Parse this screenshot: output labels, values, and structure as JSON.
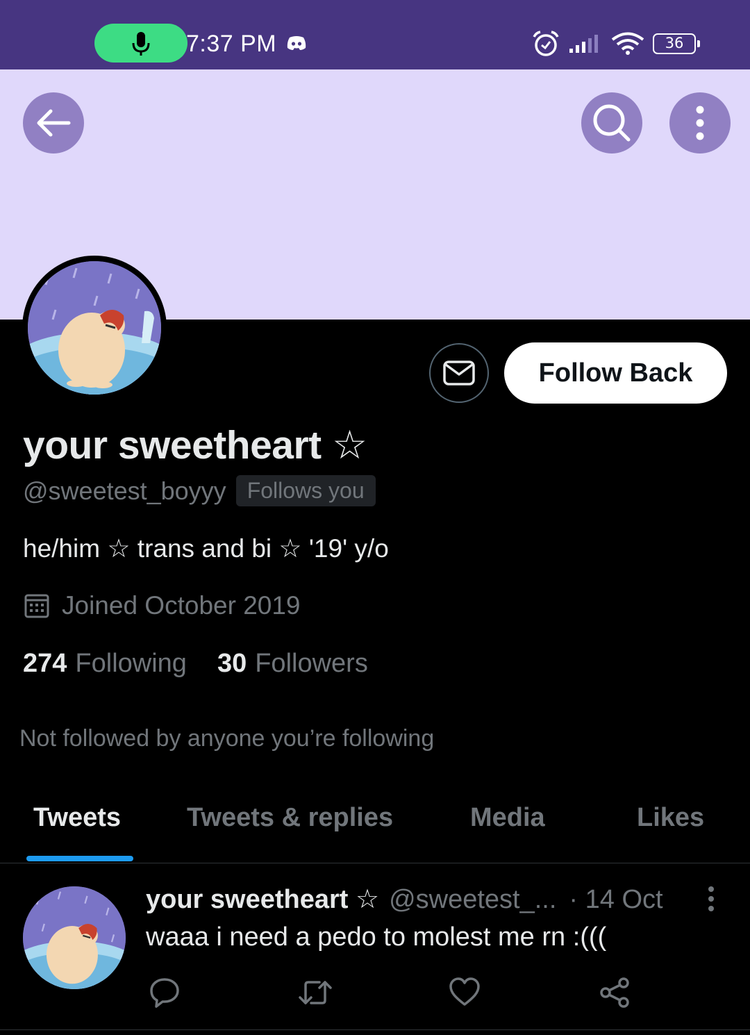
{
  "status_bar": {
    "time": "7:37 PM",
    "battery": "36",
    "colors": {
      "bar": "#473581",
      "mic_pill": "#3ddc84"
    },
    "icons": [
      "mic-icon",
      "discord-icon",
      "alarm-icon",
      "signal-icon",
      "wifi-icon",
      "battery-icon"
    ]
  },
  "header": {
    "icons": [
      "back-arrow-icon",
      "search-icon",
      "more-vertical-icon"
    ],
    "banner_color": "#e0d8fb"
  },
  "profile": {
    "follow_button": "Follow Back",
    "display_name": "your sweetheart ☆",
    "handle": "@sweetest_boyyy",
    "follows_you": "Follows you",
    "bio": "he/him ☆ trans and bi ☆ '19' y/o",
    "joined": "Joined October 2019",
    "following_count": "274",
    "following_label": "Following",
    "followers_count": "30",
    "followers_label": "Followers",
    "not_followed": "Not followed by anyone you’re following"
  },
  "tabs": [
    {
      "label": "Tweets",
      "active": true
    },
    {
      "label": "Tweets & replies",
      "active": false
    },
    {
      "label": "Media",
      "active": false
    },
    {
      "label": "Likes",
      "active": false
    }
  ],
  "tweet": {
    "name": "your sweetheart ☆",
    "handle": "@sweetest_...",
    "time": "· 14 Oct",
    "text": "waaa i need a pedo to molest me rn :(((",
    "actions": [
      "reply-icon",
      "retweet-icon",
      "like-icon",
      "share-icon"
    ]
  },
  "colors": {
    "accent": "#1d9bf0",
    "background": "#000000",
    "muted_text": "#71767b"
  }
}
